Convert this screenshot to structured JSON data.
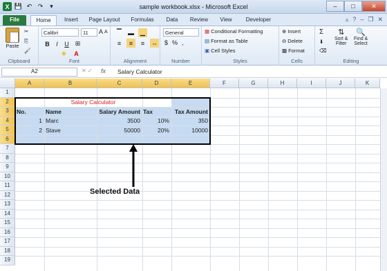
{
  "window": {
    "title": "sample workbook.xlsx - Microsoft Excel",
    "close": "✕",
    "maximize": "□",
    "minimize": "–"
  },
  "tabs": [
    {
      "label": "File"
    },
    {
      "label": "Home"
    },
    {
      "label": "Insert"
    },
    {
      "label": "Page Layout"
    },
    {
      "label": "Formulas"
    },
    {
      "label": "Data"
    },
    {
      "label": "Review"
    },
    {
      "label": "View"
    },
    {
      "label": "Developer"
    }
  ],
  "ribbon": {
    "clipboard": {
      "label": "Clipboard",
      "paste": "Paste"
    },
    "font": {
      "label": "Font",
      "name": "Calibri",
      "size": "11",
      "bold": "B",
      "italic": "I",
      "underline": "U",
      "grow": "A",
      "shrink": "A"
    },
    "alignment": {
      "label": "Alignment"
    },
    "number": {
      "label": "Number",
      "format": "General",
      "currency": "$",
      "percent": "%",
      "comma": ","
    },
    "styles": {
      "label": "Styles",
      "conditional": "Conditional Formatting",
      "table": "Format as Table",
      "cell_styles": "Cell Styles"
    },
    "cells": {
      "label": "Cells",
      "insert": "Insert",
      "delete": "Delete",
      "format": "Format"
    },
    "editing": {
      "label": "Editing",
      "sum": "Σ",
      "sort": "Sort &",
      "filter": "Filter",
      "find": "Find &",
      "select": "Select"
    }
  },
  "formula_bar": {
    "name_box": "A2",
    "fx": "fx",
    "content": "Salary Calculator"
  },
  "columns": [
    "A",
    "B",
    "C",
    "D",
    "E",
    "F",
    "G",
    "H",
    "I",
    "J",
    "K"
  ],
  "rows": [
    "1",
    "2",
    "3",
    "4",
    "5",
    "6",
    "7",
    "8",
    "9",
    "10",
    "11",
    "12",
    "13",
    "14",
    "15",
    "16",
    "17",
    "18",
    "19"
  ],
  "sheet": {
    "title": "Salary Calculator",
    "headers": [
      "No.",
      "Name",
      "Salary Amount",
      "Tax",
      "Tax Amount"
    ],
    "data": [
      [
        "1",
        "Marc",
        "3500",
        "10%",
        "350"
      ],
      [
        "2",
        "Stave",
        "50000",
        "20%",
        "10000"
      ]
    ]
  },
  "annotation": "Selected Data"
}
